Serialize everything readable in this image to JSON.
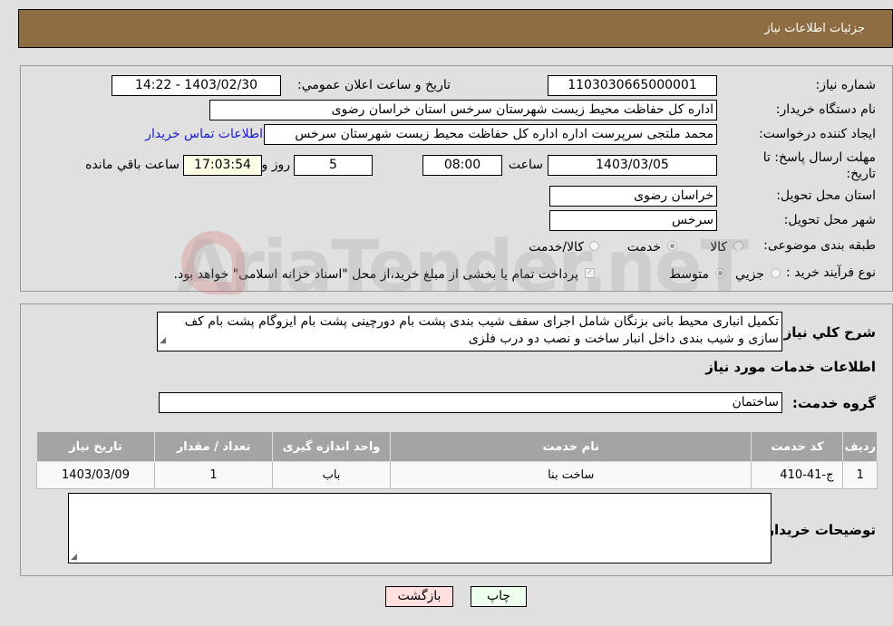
{
  "header": {
    "title": "جزئيات اطلاعات نياز"
  },
  "form": {
    "need_number_label": "شماره نیاز:",
    "need_number": "1103030665000001",
    "announce_label": "تاريخ و ساعت اعلان عمومي:",
    "announce_value": "1403/02/30 - 14:22",
    "buyer_org_label": "نام دستگاه خریدار:",
    "buyer_org": "اداره کل حفاظت محیط زیست شهرستان سرخس استان خراسان رضوی",
    "creator_label": "ایجاد کننده درخواست:",
    "creator": "محمد ملتجی سرپرست اداره اداره کل حفاظت محیط زیست شهرستان سرخس",
    "contact_link": "اطلاعات تماس خریدار",
    "deadline_label": "مهلت ارسال پاسخ: تا تاریخ:",
    "deadline_date": "1403/03/05",
    "time_label": "ساعت",
    "deadline_time": "08:00",
    "days": "5",
    "days_label": "روز و",
    "remaining_time": "17:03:54",
    "remaining_label": "ساعت باقي مانده",
    "province_label": "استان محل تحویل:",
    "province": "خراسان رضوی",
    "city_label": "شهر محل تحویل:",
    "city": "سرخس",
    "category_label": "طبقه بندی موضوعی:",
    "category_options": [
      {
        "label": "کالا",
        "checked": false
      },
      {
        "label": "خدمت",
        "checked": true
      },
      {
        "label": "کالا/خدمت",
        "checked": false
      }
    ],
    "process_label": "نوع فرآیند خرید :",
    "process_options": [
      {
        "label": "جزيي",
        "checked": false
      },
      {
        "label": "متوسط",
        "checked": true
      }
    ],
    "treasury_note": "پرداخت تمام یا بخشی از مبلغ خرید،از محل \"اسناد خزانه اسلامی\" خواهد بود.",
    "treasury_checked": true
  },
  "details": {
    "description_label": "شرح كلي نياز:",
    "description": "تکمیل انباری محیط بانی بزنگان شامل اجرای سقف شیب بندی پشت بام دورچینی پشت بام ایزوگام پشت بام کف سازی و شیب بندی داخل انبار ساخت و نصب دو درب فلزی",
    "services_heading": "اطلاعات خدمات مورد نياز",
    "service_group_label": "گروه خدمت:",
    "service_group": "ساختمان",
    "table": {
      "headers": [
        "رديف",
        "كد خدمت",
        "نام خدمت",
        "واحد اندازه گيری",
        "تعداد / مقدار",
        "تاريخ نياز"
      ],
      "rows": [
        [
          "1",
          "ج-41-410",
          "ساخت بنا",
          "باب",
          "1",
          "1403/03/09"
        ]
      ]
    },
    "buyer_notes_label": "توضيحات خريدار:",
    "buyer_notes": ""
  },
  "buttons": {
    "print": "چاپ",
    "back": "بازگشت"
  },
  "watermark": "AriaTender.neT"
}
